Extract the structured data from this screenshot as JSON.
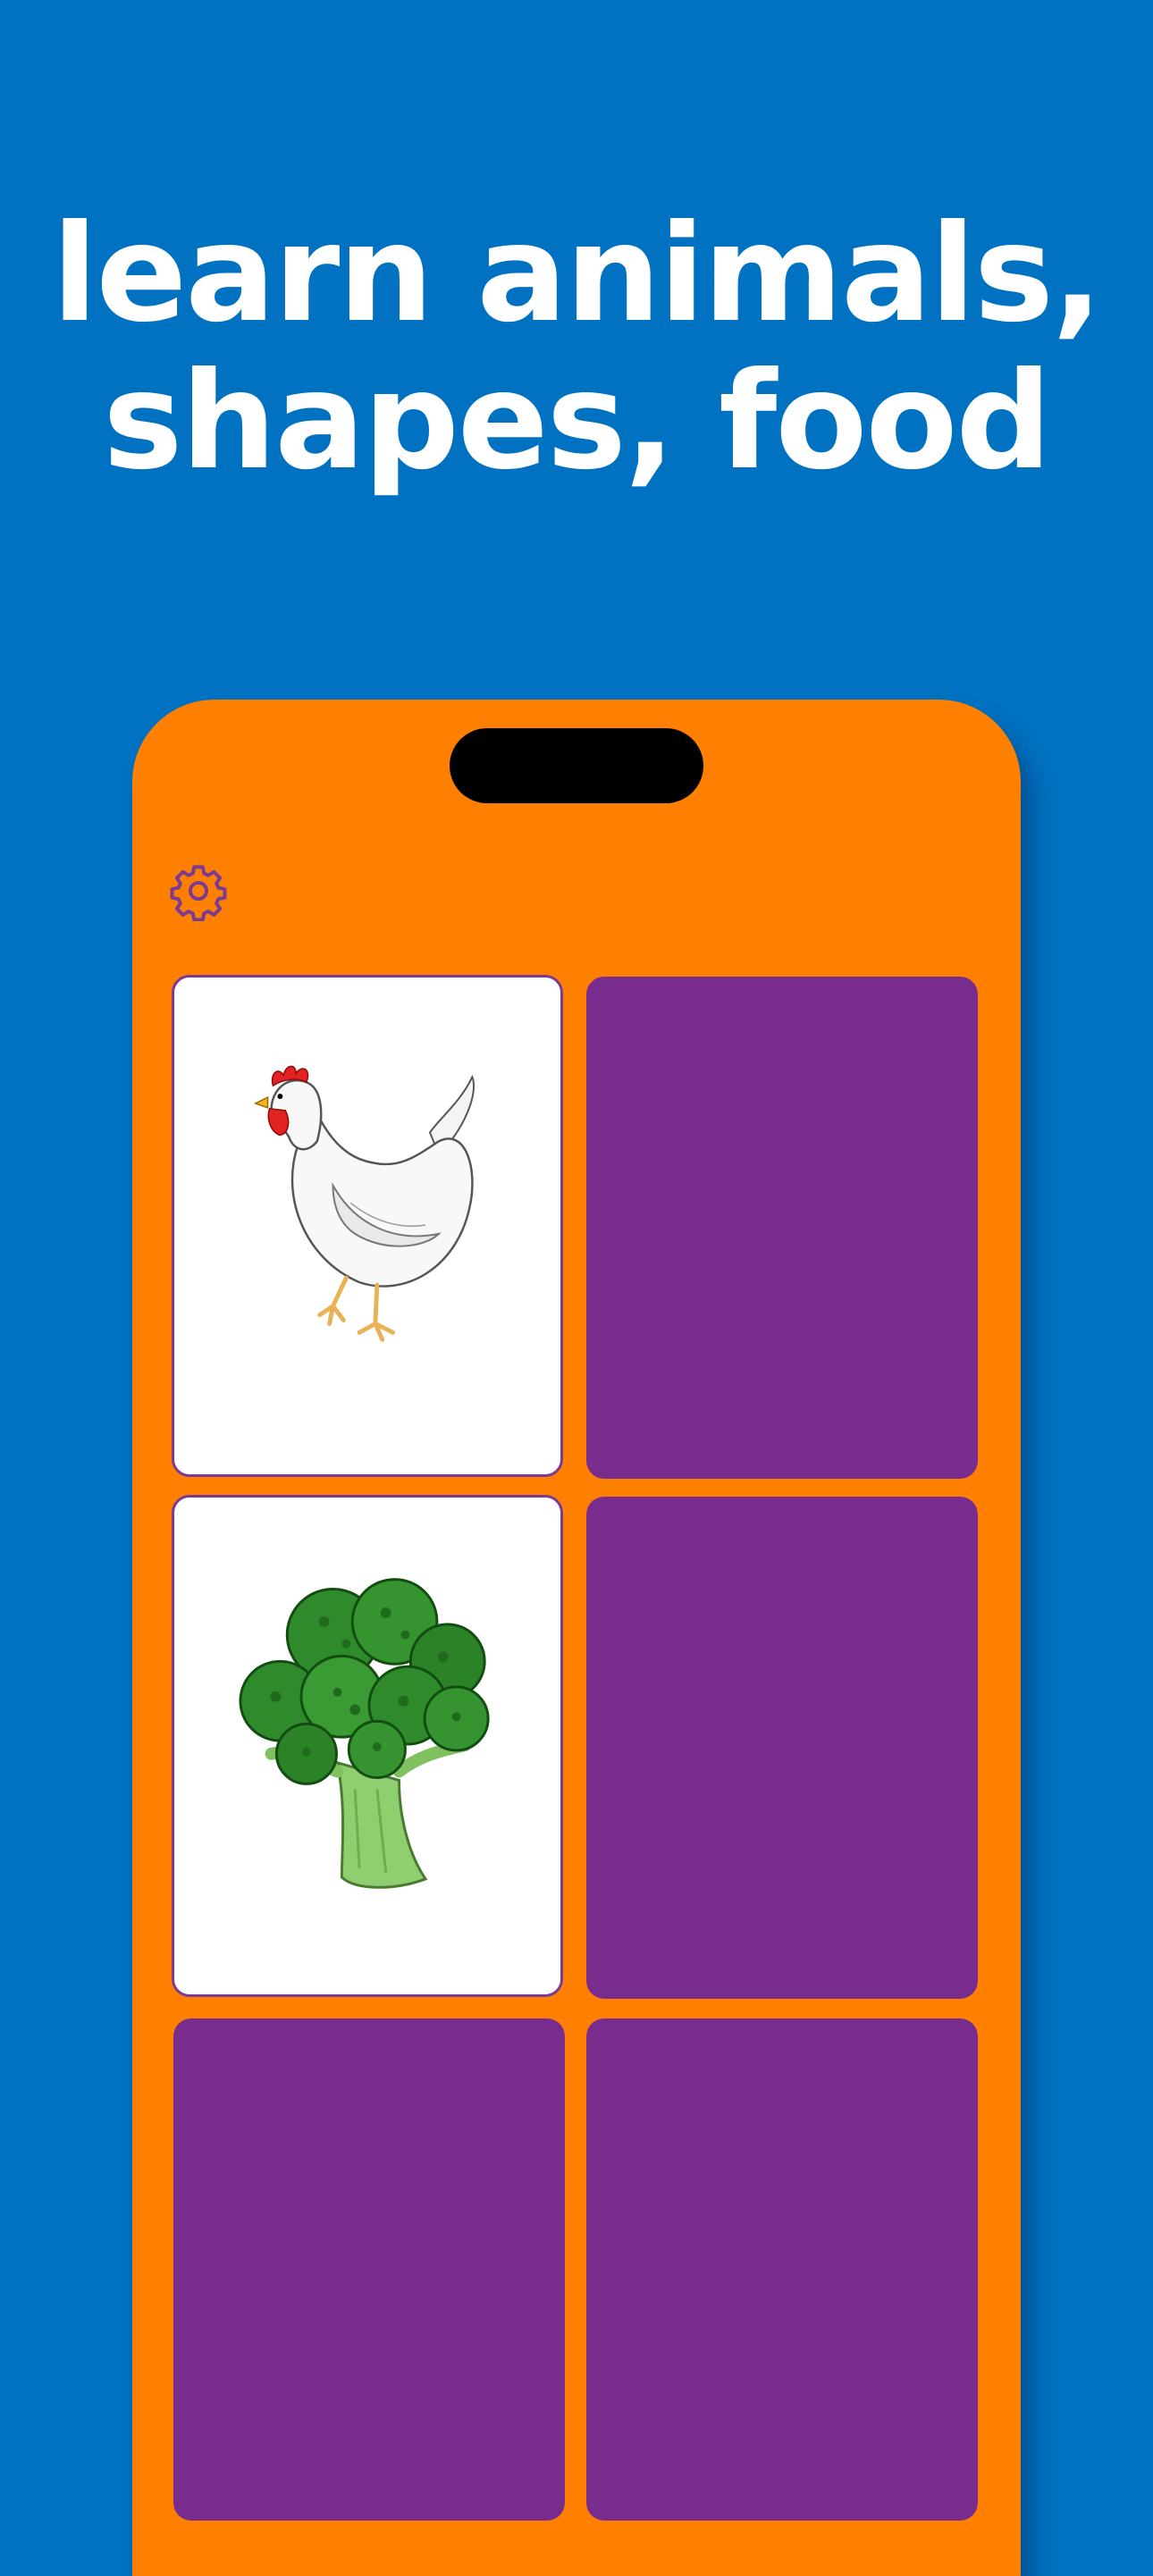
{
  "headline": {
    "line1": "learn animals,",
    "line2": "shapes, food"
  },
  "colors": {
    "background": "#0172c2",
    "phone": "#ff8000",
    "card_back": "#782d8e",
    "card_face": "#ffffff",
    "icon": "#7b3a94"
  },
  "settings": {
    "icon": "gear-icon"
  },
  "cards": [
    {
      "state": "face-up",
      "image": "chicken"
    },
    {
      "state": "face-down"
    },
    {
      "state": "face-up",
      "image": "broccoli"
    },
    {
      "state": "face-down"
    },
    {
      "state": "face-down"
    },
    {
      "state": "face-down"
    }
  ]
}
